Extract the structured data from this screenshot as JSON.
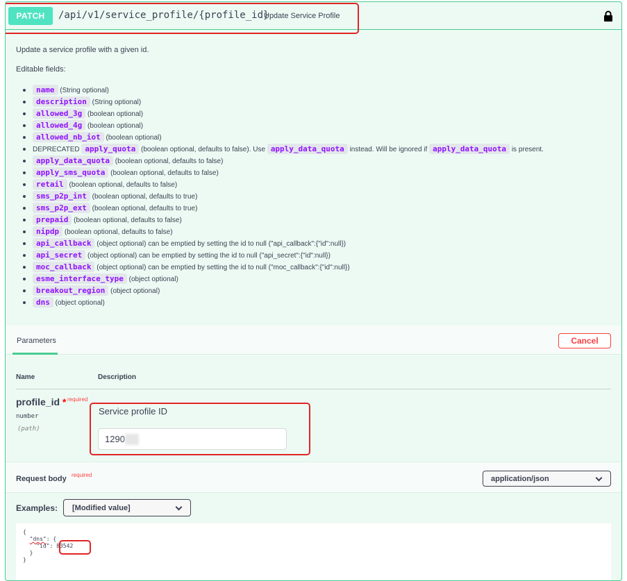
{
  "operation": {
    "method": "PATCH",
    "path": "/api/v1/service_profile/{profile_id}",
    "summary": "Update Service Profile",
    "lock_icon": "lock-icon"
  },
  "description": {
    "intro": "Update a service profile with a given id.",
    "editable_label": "Editable fields:",
    "fields": [
      {
        "name": "name",
        "note": "(String optional)"
      },
      {
        "name": "description",
        "note": "(String optional)"
      },
      {
        "name": "allowed_3g",
        "note": "(boolean optional)"
      },
      {
        "name": "allowed_4g",
        "note": "(boolean optional)"
      },
      {
        "name": "allowed_nb_iot",
        "note": "(boolean optional)"
      },
      {
        "prefix": "DEPRECATED",
        "name": "apply_quota",
        "note": "(boolean optional, defaults to false). Use",
        "ref1": "apply_data_quota",
        "mid": "instead. Will be ignored if",
        "ref2": "apply_data_quota",
        "tail": "is present."
      },
      {
        "name": "apply_data_quota",
        "note": "(boolean optional, defaults to false)"
      },
      {
        "name": "apply_sms_quota",
        "note": "(boolean optional, defaults to false)"
      },
      {
        "name": "retail",
        "note": "(boolean optional, defaults to false)"
      },
      {
        "name": "sms_p2p_int",
        "note": "(boolean optional, defaults to true)"
      },
      {
        "name": "sms_p2p_ext",
        "note": "(boolean optional, defaults to true)"
      },
      {
        "name": "prepaid",
        "note": "(boolean optional, defaults to false)"
      },
      {
        "name": "nipdp",
        "note": "(boolean optional, defaults to false)"
      },
      {
        "name": "api_callback",
        "note": "(object optional) can be emptied by setting the id to null (\"api_callback\":{\"id\":null})"
      },
      {
        "name": "api_secret",
        "note": "(object optional) can be emptied by setting the id to null (\"api_secret\":{\"id\":null})"
      },
      {
        "name": "moc_callback",
        "note": "(object optional) can be emptied by setting the id to null (\"moc_callback\":{\"id\":null})"
      },
      {
        "name": "esme_interface_type",
        "note": "(object optional)"
      },
      {
        "name": "breakout_region",
        "note": "(object optional)"
      },
      {
        "name": "dns",
        "note": "(object optional)"
      }
    ]
  },
  "parameters": {
    "tab_label": "Parameters",
    "cancel_label": "Cancel",
    "col_name": "Name",
    "col_description": "Description",
    "param": {
      "name": "profile_id",
      "star": "*",
      "required": "required",
      "type": "number",
      "in": "(path)",
      "description": "Service profile ID",
      "value": "1290"
    }
  },
  "request_body": {
    "title": "Request body",
    "required": "required",
    "content_type": "application/json",
    "examples_label": "Examples:",
    "example_selected": "[Modified value]",
    "editor_lines": [
      "{",
      "  \"dns\": {",
      "    \"id\": 83542",
      "  }",
      "}"
    ],
    "dns_key": "\"dns\"",
    "id_key": "\"id\"",
    "id_value": "83542"
  },
  "colors": {
    "accent": "#49cc90",
    "method_badge": "#50e3c2",
    "code_text": "#9012fe",
    "cancel": "#f93e3e",
    "highlight": "#e02424"
  }
}
